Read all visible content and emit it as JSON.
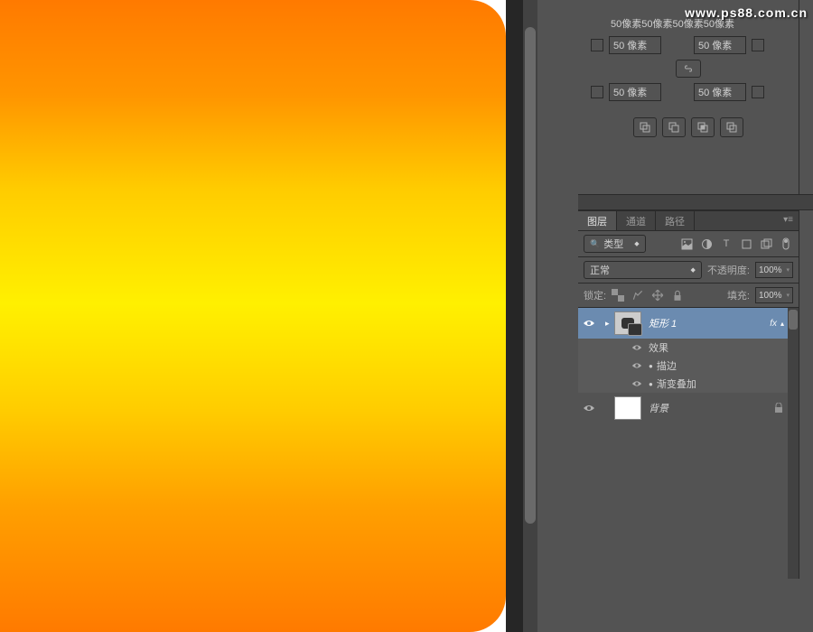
{
  "watermark": "www.ps88.com.cn",
  "properties": {
    "corner_summary": "50像素50像素50像素50像素",
    "corner_tl": "50 像素",
    "corner_tr": "50 像素",
    "corner_bl": "50 像素",
    "corner_br": "50 像素",
    "link_icon": "⬭"
  },
  "layers_panel": {
    "tabs": [
      "图层",
      "通道",
      "路径"
    ],
    "filter_label": "类型",
    "blend_mode": "正常",
    "opacity_label": "不透明度:",
    "opacity_value": "100%",
    "lock_label": "锁定:",
    "fill_label": "填充:",
    "fill_value": "100%"
  },
  "layers": {
    "shape_name": "矩形 1",
    "shape_fx_badge": "fx",
    "fx_header": "效果",
    "fx_stroke": "描边",
    "fx_gradient": "渐变叠加",
    "background_name": "背景"
  }
}
